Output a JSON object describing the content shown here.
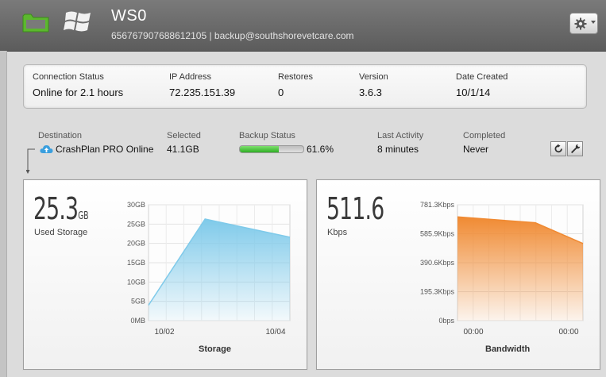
{
  "header": {
    "title": "WS0",
    "subtitle": "656767907688612105 | backup@southshorevetcare.com",
    "icons": [
      "folder-icon",
      "windows-icon",
      "gear-icon"
    ]
  },
  "info": {
    "connection_status": {
      "label": "Connection Status",
      "value": "Online for 2.1 hours"
    },
    "ip_address": {
      "label": "IP Address",
      "value": "72.235.151.39"
    },
    "restores": {
      "label": "Restores",
      "value": "0"
    },
    "version": {
      "label": "Version",
      "value": "3.6.3"
    },
    "date_created": {
      "label": "Date Created",
      "value": "10/1/14"
    }
  },
  "destination": {
    "destination_label": "Destination",
    "destination_value": "CrashPlan PRO Online",
    "selected_label": "Selected",
    "selected_value": "41.1GB",
    "backup_status_label": "Backup Status",
    "backup_status_value": "61.6%",
    "backup_progress": 0.616,
    "last_activity_label": "Last Activity",
    "last_activity_value": "8 minutes",
    "completed_label": "Completed",
    "completed_value": "Never",
    "progress_color": "#3cbc2e"
  },
  "storage": {
    "big_value": "25.3",
    "big_unit": "GB",
    "label": "Used Storage"
  },
  "bandwidth": {
    "big_value": "511.6",
    "label": "Kbps"
  },
  "chart_data": [
    {
      "type": "area",
      "title": "Storage",
      "xlabel": "Storage",
      "ylabel": "",
      "y_ticks": [
        "0MB",
        "5GB",
        "10GB",
        "15GB",
        "20GB",
        "25GB",
        "30GB"
      ],
      "x_ticks": [
        "10/02",
        "10/04"
      ],
      "ylim": [
        0,
        30
      ],
      "series": [
        {
          "x": [
            0,
            0.4,
            1.0
          ],
          "values": [
            4.0,
            26.3,
            21.6
          ]
        }
      ],
      "color": "#7fcaea"
    },
    {
      "type": "area",
      "title": "Bandwidth",
      "xlabel": "Bandwidth",
      "ylabel": "",
      "y_ticks": [
        "0bps",
        "195.3Kbps",
        "390.6Kbps",
        "585.9Kbps",
        "781.3Kbps"
      ],
      "x_ticks": [
        "00:00",
        "00:00"
      ],
      "ylim": [
        0,
        781.3
      ],
      "series": [
        {
          "x": [
            0,
            0.62,
            1.0
          ],
          "values": [
            700,
            660,
            520
          ]
        }
      ],
      "color": "#f08a32"
    }
  ]
}
